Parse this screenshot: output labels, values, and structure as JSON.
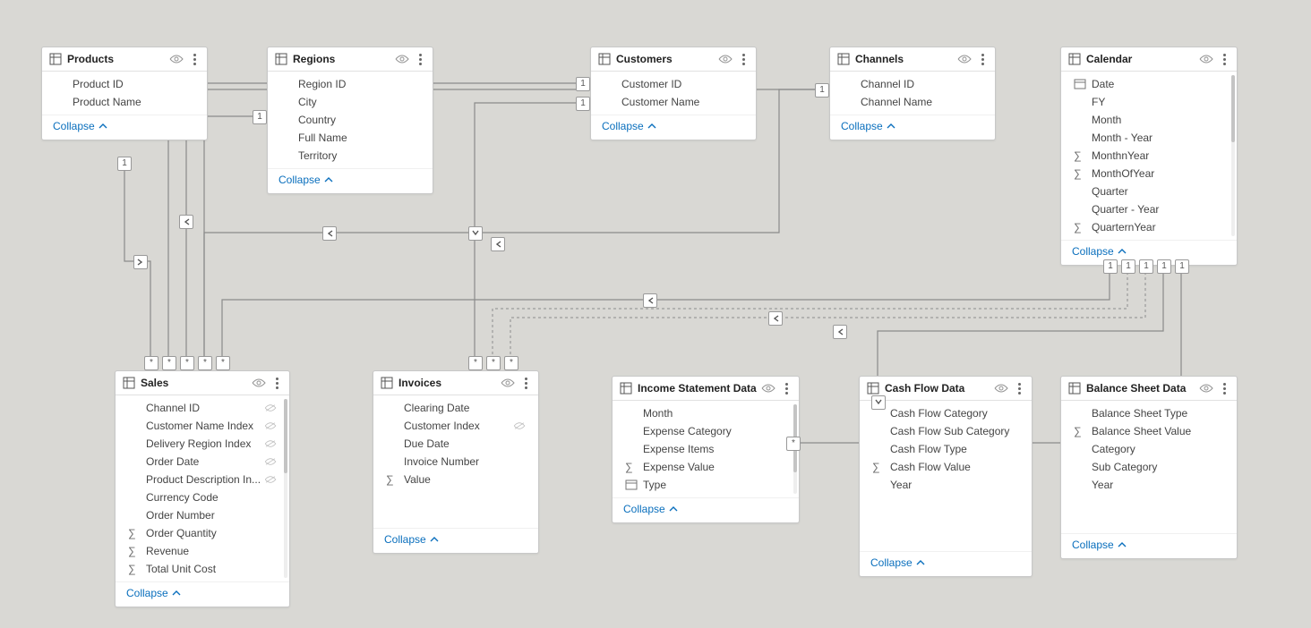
{
  "collapse_label": "Collapse",
  "tables": {
    "products": {
      "title": "Products",
      "fields": [
        {
          "k": "pid",
          "label": "Product ID"
        },
        {
          "k": "pname",
          "label": "Product Name"
        }
      ]
    },
    "regions": {
      "title": "Regions",
      "fields": [
        {
          "k": "rid",
          "label": "Region ID"
        },
        {
          "k": "city",
          "label": "City"
        },
        {
          "k": "country",
          "label": "Country"
        },
        {
          "k": "fname",
          "label": "Full Name"
        },
        {
          "k": "terr",
          "label": "Territory"
        }
      ]
    },
    "customers": {
      "title": "Customers",
      "fields": [
        {
          "k": "cid",
          "label": "Customer ID"
        },
        {
          "k": "cname",
          "label": "Customer Name"
        }
      ]
    },
    "channels": {
      "title": "Channels",
      "fields": [
        {
          "k": "chid",
          "label": "Channel ID"
        },
        {
          "k": "chname",
          "label": "Channel Name"
        }
      ]
    },
    "calendar": {
      "title": "Calendar",
      "fields": [
        {
          "k": "date",
          "label": "Date",
          "icon": "hier"
        },
        {
          "k": "fy",
          "label": "FY"
        },
        {
          "k": "month",
          "label": "Month"
        },
        {
          "k": "monthyear",
          "label": "Month - Year"
        },
        {
          "k": "monthnyear",
          "label": "MonthnYear",
          "icon": "sum"
        },
        {
          "k": "monthofyear",
          "label": "MonthOfYear",
          "icon": "sum"
        },
        {
          "k": "quarter",
          "label": "Quarter"
        },
        {
          "k": "quarteryear",
          "label": "Quarter - Year"
        },
        {
          "k": "quarternyear",
          "label": "QuarternYear",
          "icon": "sum"
        }
      ]
    },
    "sales": {
      "title": "Sales",
      "fields": [
        {
          "k": "schan",
          "label": "Channel ID",
          "hidden": true
        },
        {
          "k": "scustidx",
          "label": "Customer Name Index",
          "hidden": true
        },
        {
          "k": "sdelreg",
          "label": "Delivery Region Index",
          "hidden": true
        },
        {
          "k": "sodate",
          "label": "Order Date",
          "hidden": true
        },
        {
          "k": "sproddesc",
          "label": "Product Description In...",
          "hidden": true
        },
        {
          "k": "scurr",
          "label": "Currency Code"
        },
        {
          "k": "sordnum",
          "label": "Order Number"
        },
        {
          "k": "sordqty",
          "label": "Order Quantity",
          "icon": "sum"
        },
        {
          "k": "srev",
          "label": "Revenue",
          "icon": "sum"
        },
        {
          "k": "stuc",
          "label": "Total Unit Cost",
          "icon": "sum"
        }
      ]
    },
    "invoices": {
      "title": "Invoices",
      "fields": [
        {
          "k": "iclr",
          "label": "Clearing Date"
        },
        {
          "k": "icidx",
          "label": "Customer Index",
          "hidden": true
        },
        {
          "k": "idue",
          "label": "Due Date"
        },
        {
          "k": "inum",
          "label": "Invoice Number"
        },
        {
          "k": "ival",
          "label": "Value",
          "icon": "sum"
        }
      ]
    },
    "income": {
      "title": "Income Statement Data",
      "fields": [
        {
          "k": "inmonth",
          "label": "Month"
        },
        {
          "k": "inexcat",
          "label": "Expense Category"
        },
        {
          "k": "inexitm",
          "label": "Expense Items"
        },
        {
          "k": "inexval",
          "label": "Expense Value",
          "icon": "sum"
        },
        {
          "k": "intype",
          "label": "Type",
          "icon": "hier"
        }
      ]
    },
    "cashflow": {
      "title": "Cash Flow Data",
      "fields": [
        {
          "k": "cfcat",
          "label": "Cash Flow Category"
        },
        {
          "k": "cfsubcat",
          "label": "Cash Flow Sub Category"
        },
        {
          "k": "cftype",
          "label": "Cash Flow Type"
        },
        {
          "k": "cfval",
          "label": "Cash Flow Value",
          "icon": "sum"
        },
        {
          "k": "cfyear",
          "label": "Year"
        }
      ]
    },
    "balance": {
      "title": "Balance Sheet Data",
      "fields": [
        {
          "k": "bstype",
          "label": "Balance Sheet Type"
        },
        {
          "k": "bsval",
          "label": "Balance Sheet Value",
          "icon": "sum"
        },
        {
          "k": "bscat",
          "label": "Category"
        },
        {
          "k": "bssub",
          "label": "Sub Category"
        },
        {
          "k": "bsyear",
          "label": "Year"
        }
      ]
    }
  },
  "endcaps": {
    "products_one": "1",
    "regions_one": "1",
    "customers_one_l": "1",
    "customers_one_r": "1",
    "channels_one": "1",
    "calendar_one_a": "1",
    "calendar_one_b": "1",
    "calendar_one_c": "1",
    "calendar_one_d": "1",
    "calendar_one_e": "1",
    "sales_star_a": "*",
    "sales_star_b": "*",
    "sales_star_c": "*",
    "sales_star_d": "*",
    "sales_star_e": "*",
    "inv_star_a": "*",
    "inv_star_b": "*",
    "inv_star_c": "*",
    "income_star": "*"
  }
}
